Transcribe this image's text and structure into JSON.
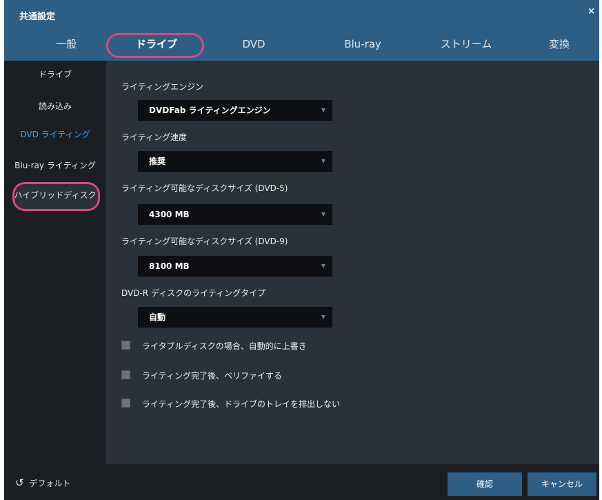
{
  "window": {
    "title": "共通設定",
    "close_icon": "×"
  },
  "tabs": [
    {
      "label": "一般"
    },
    {
      "label": "ドライブ"
    },
    {
      "label": "DVD"
    },
    {
      "label": "Blu-ray"
    },
    {
      "label": "ストリーム"
    },
    {
      "label": "変換"
    }
  ],
  "sidebar": {
    "items": [
      {
        "label": "ドライブ"
      },
      {
        "label": "読み込み"
      },
      {
        "label": "DVD ライティング"
      },
      {
        "label": "Blu-ray ライティング"
      },
      {
        "label": "ハイブリッドディスク"
      }
    ]
  },
  "settings": {
    "engine_label": "ライティングエンジン",
    "engine_value": "DVDFab ライティングエンジン",
    "speed_label": "ライティング速度",
    "speed_value": "推奨",
    "size5_label": "ライティング可能なディスクサイズ (DVD-5)",
    "size5_value": "4300 MB",
    "size9_label": "ライティング可能なディスクサイズ (DVD-9)",
    "size9_value": "8100 MB",
    "dvdr_label": "DVD-R ディスクのライティングタイプ",
    "dvdr_value": "自動",
    "checkboxes": [
      {
        "label": "ライタブルディスクの場合、自動的に上書き",
        "checked": false
      },
      {
        "label": "ライティング完了後、ベリファイする",
        "checked": false
      },
      {
        "label": "ライティング完了後、ドライブのトレイを排出しない",
        "checked": false
      }
    ]
  },
  "footer": {
    "default_icon": "↺",
    "default_label": "デフォルト",
    "ok_label": "確認",
    "cancel_label": "キャンセル"
  },
  "colors": {
    "accent": "#2f5e84",
    "highlight_ring": "#d9497a",
    "active_link": "#3ba5ff"
  }
}
